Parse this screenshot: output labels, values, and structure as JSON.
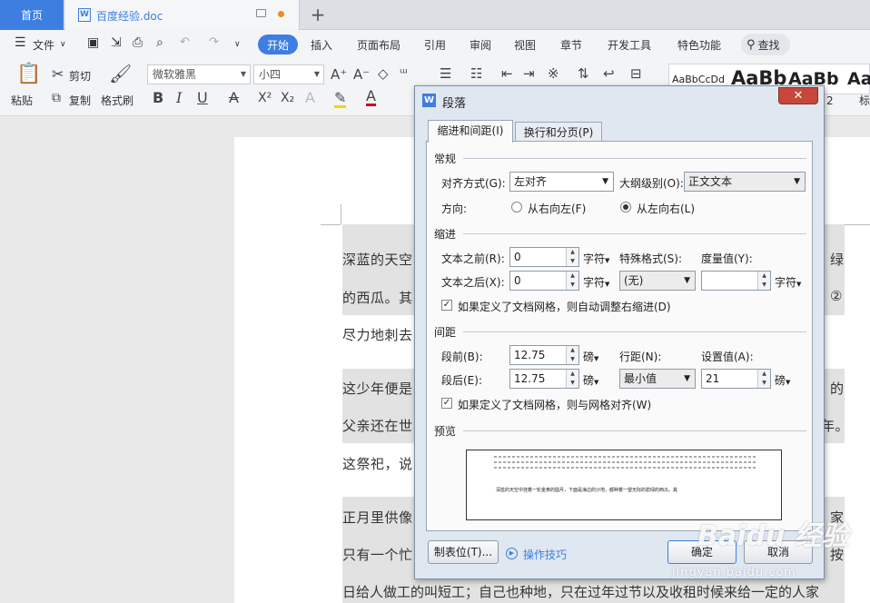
{
  "tabs": {
    "home": "首页",
    "doc": "百度经验.doc"
  },
  "menu": {
    "file": "文件",
    "items": [
      "开始",
      "插入",
      "页面布局",
      "引用",
      "审阅",
      "视图",
      "章节",
      "开发工具",
      "特色功能"
    ],
    "search": "查找"
  },
  "ribbon": {
    "paste": "粘贴",
    "cut": "剪切",
    "copy": "复制",
    "format_painter": "格式刷",
    "font": "微软雅黑",
    "size": "小四",
    "styles": "AaBbCcDd",
    "styles_big": "AaBb",
    "styles_big2": "AaBb",
    "styles_big3": "Aal",
    "style_num": "2",
    "style_caption": "标"
  },
  "document": {
    "lines": [
      {
        "left": "深蓝的天空",
        "right": "绿"
      },
      {
        "left": "的西瓜。其",
        "right": "②"
      },
      {
        "left": "尽力地刺去",
        "right": ""
      },
      {
        "left": "这少年便是",
        "right": "的"
      },
      {
        "left": "父亲还在世",
        "right": "年。"
      },
      {
        "left": "这祭祀，说",
        "right": ""
      },
      {
        "left": "正月里供像",
        "right": "家"
      },
      {
        "left": "只有一个忙",
        "right": "按"
      },
      {
        "left": "日给人做工的叫短工；自己也种地，只在过年过节以及收租时候来给一定的人家",
        "right": ""
      }
    ]
  },
  "dialog": {
    "title": "段落",
    "close": "✕",
    "tab_indent": "缩进和间距(I)",
    "tab_breaks": "换行和分页(P)",
    "sec_general": "常规",
    "align_label": "对齐方式(G):",
    "align_value": "左对齐",
    "outline_label": "大纲级别(O):",
    "outline_value": "正文文本",
    "direction_label": "方向:",
    "rtl": "从右向左(F)",
    "ltr": "从左向右(L)",
    "sec_indent": "缩进",
    "before_text_label": "文本之前(R):",
    "before_text_value": "0",
    "after_text_label": "文本之后(X):",
    "after_text_value": "0",
    "unit_chars": "字符",
    "special_label": "特殊格式(S):",
    "special_value": "(无)",
    "measure_label": "度量值(Y):",
    "measure_value": "",
    "auto_indent": "如果定义了文档网格，则自动调整右缩进(D)",
    "sec_spacing": "间距",
    "before_label": "段前(B):",
    "before_value": "12.75",
    "after_label": "段后(E):",
    "after_value": "12.75",
    "unit_pt": "磅",
    "line_spacing_label": "行距(N):",
    "line_spacing_value": "最小值",
    "setting_label": "设置值(A):",
    "setting_value": "21",
    "snap_grid": "如果定义了文档网格，则与网格对齐(W)",
    "sec_preview": "预览",
    "preview_text": "深蓝的天空中挂着一轮金黄的圆月，下面是海边的沙地，都种着一望无际的碧绿的西瓜。其",
    "tabs_button": "制表位(T)...",
    "tips": "操作技巧",
    "ok": "确定",
    "cancel": "取消"
  },
  "watermark": {
    "brand": "Baidu 经验",
    "url": "jingyan.baidu.com"
  }
}
